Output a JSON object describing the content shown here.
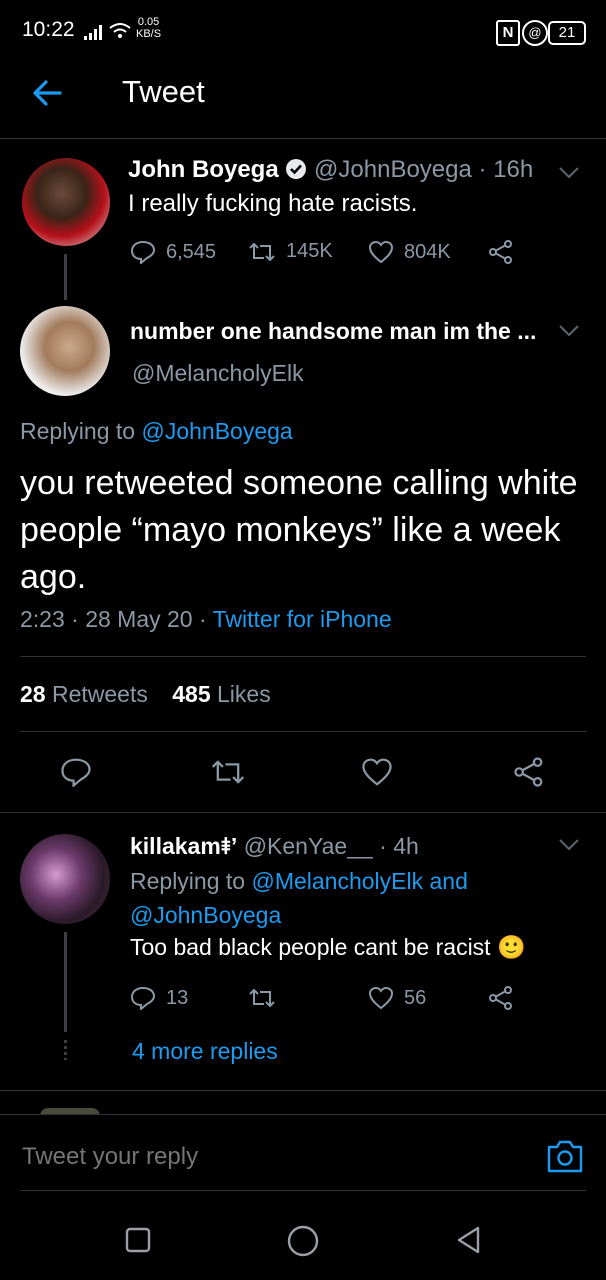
{
  "status_bar": {
    "time": "10:22",
    "net_speed_value": "0.05",
    "net_speed_unit": "KB/S",
    "battery": "21"
  },
  "header": {
    "title": "Tweet"
  },
  "parent_tweet": {
    "author_name": "John Boyega",
    "handle": "@JohnBoyega",
    "time": "· 16h",
    "text": "I really fucking hate racists.",
    "replies": "6,545",
    "retweets": "145K",
    "likes": "804K"
  },
  "main_tweet": {
    "author_name": "number one handsome man im the ...",
    "handle": "@MelancholyElk",
    "replying_prefix": "Replying to",
    "replying_to": "@JohnBoyega",
    "text": "you retweeted someone calling white people “mayo monkeys” like a week ago.",
    "timestamp": "2:23 · 28 May 20 ·",
    "source": "Twitter for iPhone",
    "retweet_count": "28",
    "retweet_label": "Retweets",
    "like_count": "485",
    "like_label": "Likes"
  },
  "reply_tweet": {
    "author_name": "killakam⯒’",
    "handle": "@KenYae__",
    "time": "· 4h",
    "replying_prefix": "Replying to",
    "replying_to": "@MelancholyElk and @JohnBoyega",
    "text": "Too bad black people cant be racist",
    "emoji": "🙂",
    "replies": "13",
    "likes": "56",
    "more_replies": "4 more replies"
  },
  "compose": {
    "placeholder": "Tweet your reply"
  },
  "colors": {
    "accent": "#1d9bf0",
    "background": "#000000",
    "muted": "#8b98a5"
  }
}
